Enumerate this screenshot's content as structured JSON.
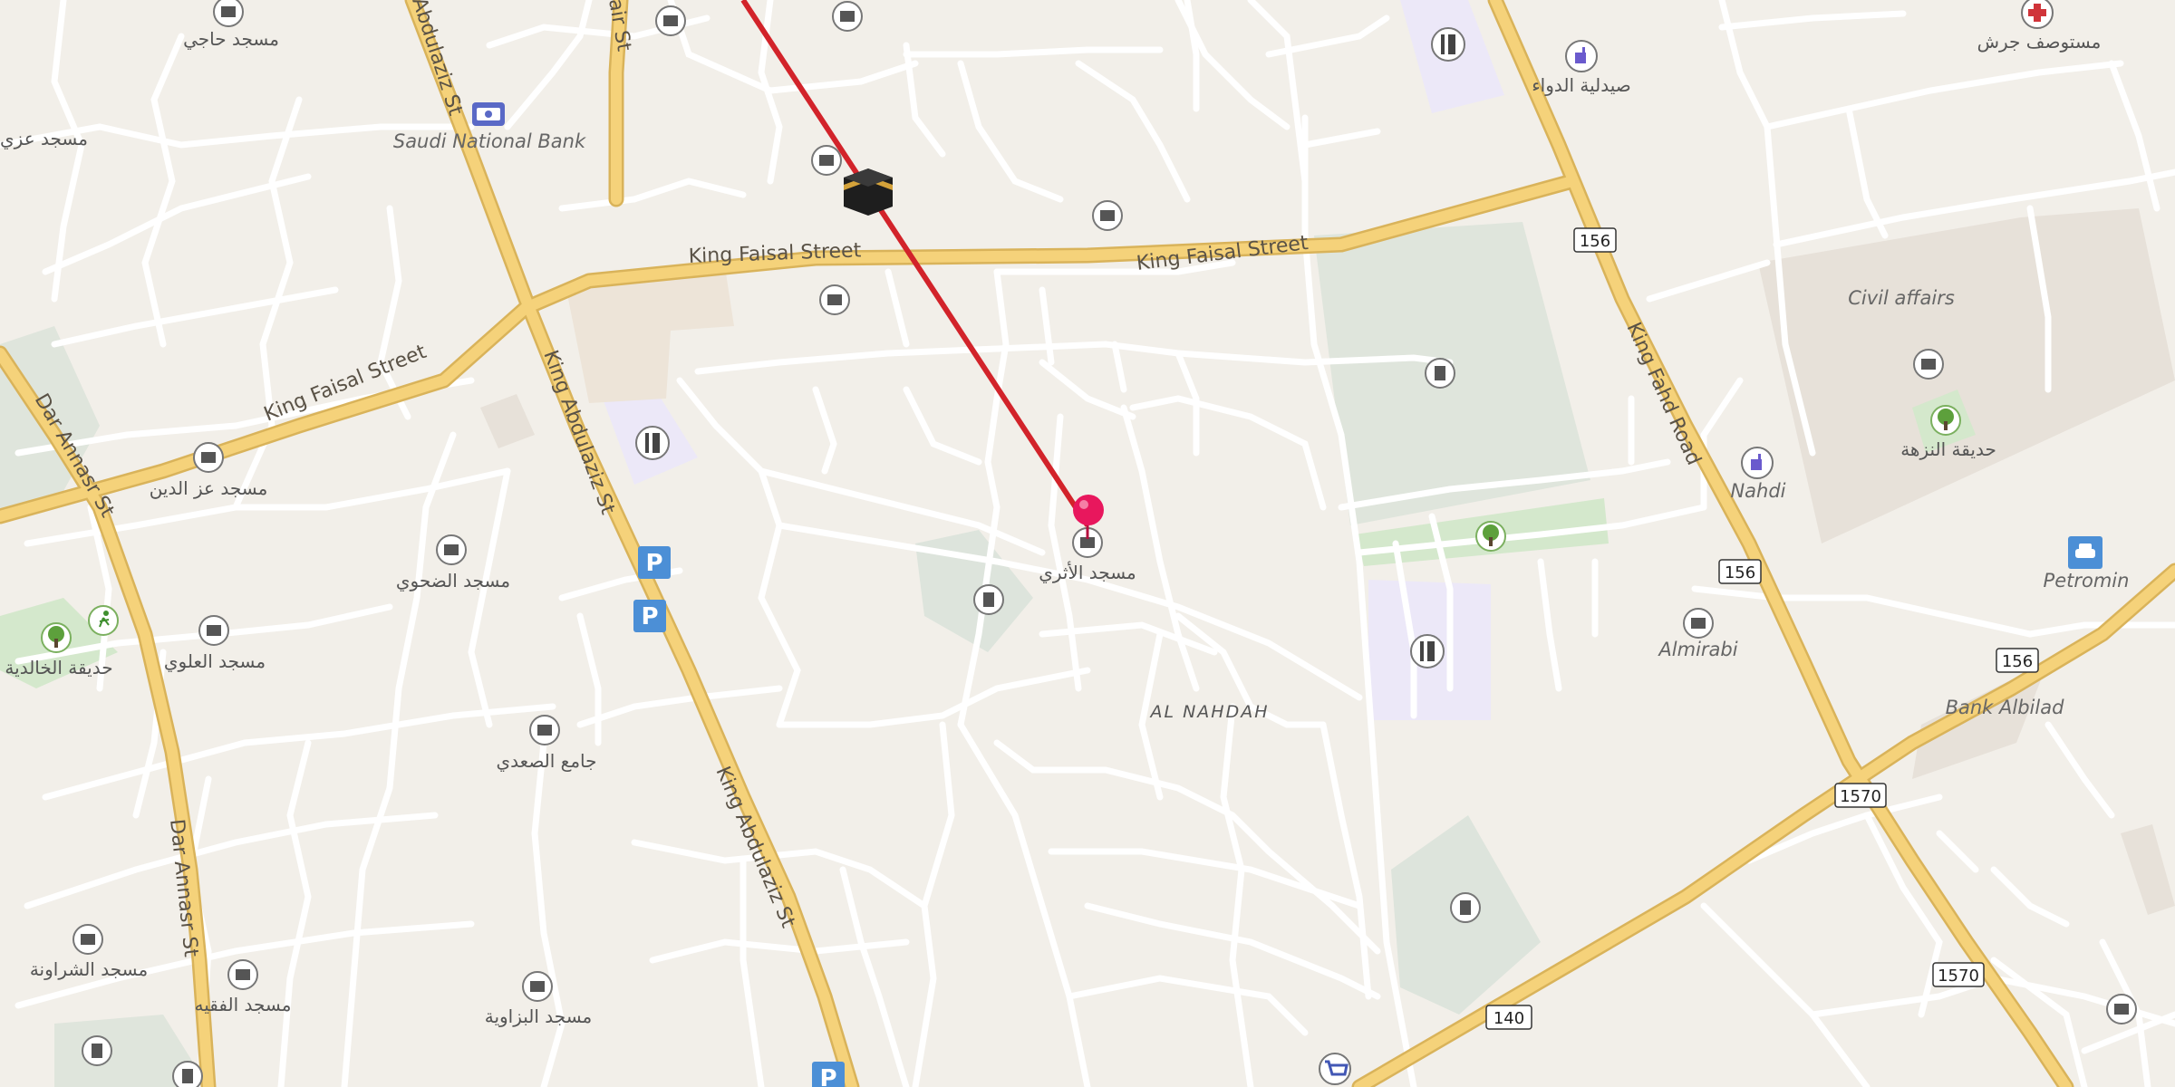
{
  "map": {
    "district": "AL NAHDAH",
    "roads": [
      {
        "id": "kf1",
        "name": "King Faisal Street"
      },
      {
        "id": "kf2",
        "name": "King Faisal Street"
      },
      {
        "id": "kf3",
        "name": "King Faisal Street"
      },
      {
        "id": "ka1",
        "name": "King Abdulaziz St"
      },
      {
        "id": "ka2",
        "name": "King Abdulaziz St"
      },
      {
        "id": "ka3",
        "name": "Abdulaziz St"
      },
      {
        "id": "dar1",
        "name": "Dar Annasr St"
      },
      {
        "id": "dar2",
        "name": "Dar Annasr St"
      },
      {
        "id": "kfahd",
        "name": "King Fahd Road"
      },
      {
        "id": "fair",
        "name": "air St"
      }
    ],
    "shields": [
      "156",
      "156",
      "156",
      "1570",
      "1570",
      "140"
    ],
    "places": [
      {
        "id": "snb",
        "name": "Saudi National Bank",
        "icon": "bank-icon"
      },
      {
        "id": "civil",
        "name": "Civil affairs",
        "icon": ""
      },
      {
        "id": "nahdi",
        "name": "Nahdi",
        "icon": "pharmacy-icon"
      },
      {
        "id": "petromin",
        "name": "Petromin",
        "icon": "car-service-icon"
      },
      {
        "id": "almirabi",
        "name": "Almirabi",
        "icon": "mosque-icon"
      },
      {
        "id": "albilad",
        "name": "Bank Albilad",
        "icon": ""
      },
      {
        "id": "pharm",
        "name": "صيدلية الدواء",
        "icon": "pharmacy-icon"
      },
      {
        "id": "hosp",
        "name": "مستوصف جرش",
        "icon": "hospital-icon"
      },
      {
        "id": "park1",
        "name": "حديقة النزهة",
        "icon": "park-icon"
      },
      {
        "id": "park2",
        "name": "حديقة الخالدية",
        "icon": "park-icon"
      },
      {
        "id": "m1",
        "name": "مسجد حاجي",
        "icon": "mosque-icon"
      },
      {
        "id": "m2",
        "name": "مسجد عز الدين",
        "icon": "mosque-icon"
      },
      {
        "id": "m3",
        "name": "مسجد الضحوي",
        "icon": "mosque-icon"
      },
      {
        "id": "m4",
        "name": "مسجد العلوي",
        "icon": "mosque-icon"
      },
      {
        "id": "m5",
        "name": "جامع الصعدي",
        "icon": "mosque-icon"
      },
      {
        "id": "m6",
        "name": "مسجد الشراونة",
        "icon": "mosque-icon"
      },
      {
        "id": "m7",
        "name": "مسجد الفقيه",
        "icon": "mosque-icon"
      },
      {
        "id": "m8",
        "name": "مسجد البزاوية",
        "icon": "mosque-icon"
      },
      {
        "id": "m9",
        "name": "مسجد الأثري",
        "icon": "mosque-icon"
      },
      {
        "id": "m10",
        "name": "مسجد عزي",
        "icon": ""
      }
    ],
    "marker": {
      "label": "مسجد الأثري",
      "icon": "map-pin-icon",
      "color": "#e8175d"
    },
    "qibla": {
      "icon": "kaaba-icon",
      "color": "#d2232a"
    },
    "colors": {
      "background": "#f2efe9",
      "major_road": "#f5d27a",
      "major_road_casing": "#d9b35a",
      "minor_road": "#ffffff",
      "park": "#dfe6dc",
      "school": "#ece8f8",
      "qibla_line": "#d2232a",
      "poi_blue": "#4c8fd6"
    }
  }
}
